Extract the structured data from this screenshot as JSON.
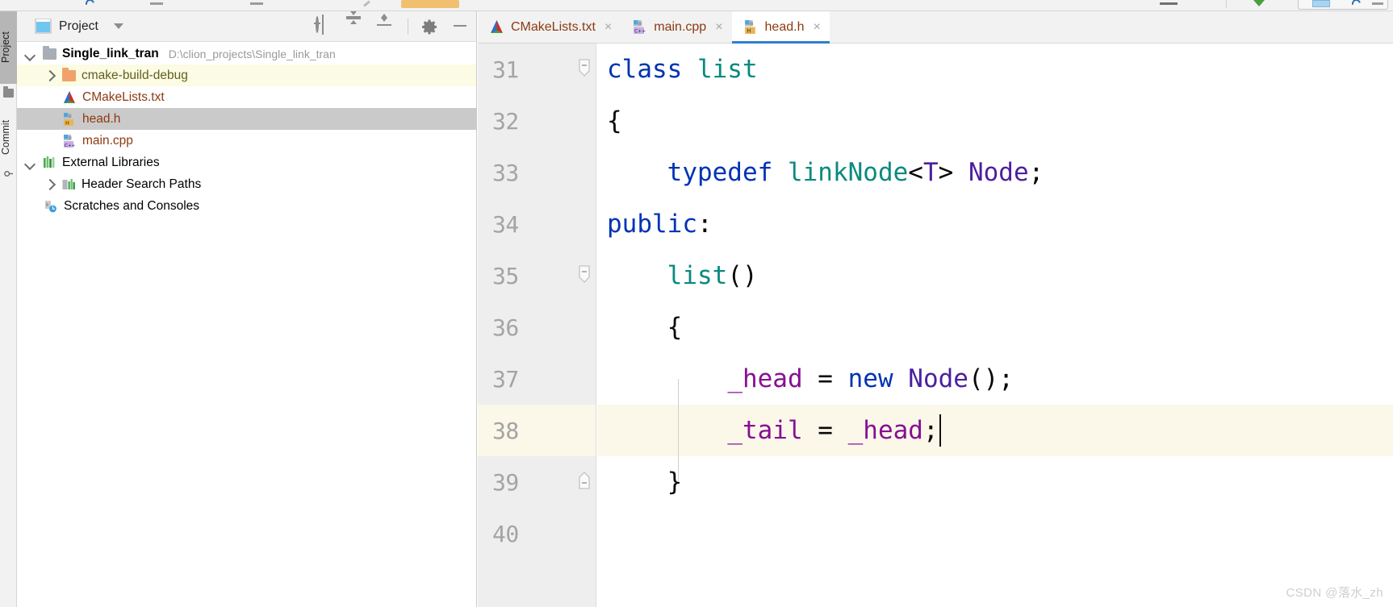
{
  "window": {
    "top_toolbar_partial": true
  },
  "tool_strip": {
    "tabs": [
      {
        "label": "Project",
        "selected": true,
        "icon": "project-folder-icon"
      },
      {
        "label": "Commit",
        "selected": false,
        "icon": "commit-icon"
      }
    ]
  },
  "project_panel": {
    "title": "Project",
    "title_icon": "project-window-icon",
    "dropdown_icon": "chevron-down-icon",
    "tools": [
      {
        "name": "select-opened-file-button",
        "icon": "target-icon"
      },
      {
        "name": "expand-all-button",
        "icon": "expand-all-icon"
      },
      {
        "name": "collapse-all-button",
        "icon": "collapse-all-icon"
      },
      {
        "name": "settings-button",
        "icon": "gear-icon"
      },
      {
        "name": "hide-button",
        "icon": "minimize-icon"
      }
    ],
    "tree": [
      {
        "label": "Single_link_tran",
        "path": "D:\\clion_projects\\Single_link_tran",
        "icon": "folder-grey-icon",
        "arrow": "open",
        "indent": 0,
        "highlight": "none",
        "kind": "module"
      },
      {
        "label": "cmake-build-debug",
        "path": "",
        "icon": "folder-orange-icon",
        "arrow": "closed",
        "indent": 1,
        "highlight": "yellow",
        "kind": "folder"
      },
      {
        "label": "CMakeLists.txt",
        "path": "",
        "icon": "cmake-file-icon",
        "arrow": "none",
        "indent": 1,
        "highlight": "none",
        "kind": "file"
      },
      {
        "label": "head.h",
        "path": "",
        "icon": "header-file-icon",
        "arrow": "none",
        "indent": 1,
        "highlight": "grey",
        "kind": "file"
      },
      {
        "label": "main.cpp",
        "path": "",
        "icon": "cpp-file-icon",
        "arrow": "none",
        "indent": 1,
        "highlight": "none",
        "kind": "file"
      },
      {
        "label": "External Libraries",
        "path": "",
        "icon": "external-libraries-icon",
        "arrow": "open",
        "indent": 0,
        "highlight": "none",
        "kind": "node"
      },
      {
        "label": "Header Search Paths",
        "path": "",
        "icon": "header-search-paths-icon",
        "arrow": "closed",
        "indent": 1,
        "highlight": "none",
        "kind": "node"
      },
      {
        "label": "Scratches and Consoles",
        "path": "",
        "icon": "scratches-icon",
        "arrow": "none",
        "indent": 0,
        "highlight": "none",
        "kind": "node"
      }
    ]
  },
  "editor": {
    "tabs": [
      {
        "label": "CMakeLists.txt",
        "icon": "cmake-file-icon",
        "active": false,
        "close_glyph": "×"
      },
      {
        "label": "main.cpp",
        "icon": "cpp-file-icon",
        "active": false,
        "close_glyph": "×"
      },
      {
        "label": "head.h",
        "icon": "header-file-icon",
        "active": true,
        "close_glyph": "×"
      }
    ],
    "active_tab": "head.h",
    "caret_line": 38,
    "highlighted_line": 38,
    "line_numbers": [
      "31",
      "32",
      "33",
      "34",
      "35",
      "36",
      "37",
      "38",
      "39",
      "40"
    ],
    "fold_markers": [
      {
        "line": "31",
        "type": "collapse-down"
      },
      {
        "line": "35",
        "type": "collapse-down"
      },
      {
        "line": "39",
        "type": "collapse-up"
      }
    ],
    "code_lines": [
      {
        "number": "31",
        "tokens": [
          {
            "t": "class ",
            "c": "kw"
          },
          {
            "t": "list",
            "c": "type"
          }
        ]
      },
      {
        "number": "32",
        "tokens": [
          {
            "t": "{",
            "c": "plain"
          }
        ]
      },
      {
        "number": "33",
        "tokens": [
          {
            "t": "    ",
            "c": "plain"
          },
          {
            "t": "typedef ",
            "c": "kw"
          },
          {
            "t": "linkNode",
            "c": "type"
          },
          {
            "t": "<",
            "c": "plain"
          },
          {
            "t": "T",
            "c": "purple"
          },
          {
            "t": "> ",
            "c": "plain"
          },
          {
            "t": "Node",
            "c": "purple"
          },
          {
            "t": ";",
            "c": "plain"
          }
        ]
      },
      {
        "number": "34",
        "tokens": [
          {
            "t": "public",
            "c": "kw"
          },
          {
            "t": ":",
            "c": "plain"
          }
        ]
      },
      {
        "number": "35",
        "tokens": [
          {
            "t": "    ",
            "c": "plain"
          },
          {
            "t": "list",
            "c": "type"
          },
          {
            "t": "()",
            "c": "plain"
          }
        ]
      },
      {
        "number": "36",
        "tokens": [
          {
            "t": "    {",
            "c": "plain"
          }
        ]
      },
      {
        "number": "37",
        "tokens": [
          {
            "t": "        ",
            "c": "plain"
          },
          {
            "t": "_head",
            "c": "field"
          },
          {
            "t": " = ",
            "c": "plain"
          },
          {
            "t": "new ",
            "c": "kw"
          },
          {
            "t": "Node",
            "c": "purple"
          },
          {
            "t": "();",
            "c": "plain"
          }
        ]
      },
      {
        "number": "38",
        "tokens": [
          {
            "t": "        ",
            "c": "plain"
          },
          {
            "t": "_tail",
            "c": "field"
          },
          {
            "t": " = ",
            "c": "plain"
          },
          {
            "t": "_head",
            "c": "field"
          },
          {
            "t": ";",
            "c": "plain"
          }
        ]
      },
      {
        "number": "39",
        "tokens": [
          {
            "t": "    }",
            "c": "plain"
          }
        ]
      },
      {
        "number": "40",
        "tokens": []
      }
    ]
  },
  "watermark": "CSDN @落水_zh",
  "colors": {
    "keyword": "#0033b3",
    "type": "#0a8a7e",
    "identifier_purple": "#4b1f9e",
    "field_magenta": "#871094",
    "plain": "#080808",
    "tab_accent": "#2f7fd1",
    "selection_grey": "#cacaca",
    "highlight_yellow": "#fcfbe3",
    "gutter_bg": "#eeeeee",
    "file_label": "#8c3a10"
  }
}
